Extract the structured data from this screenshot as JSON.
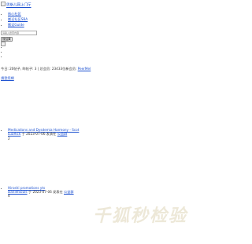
{
  "header": {
    "logo_alt": "思斯儿网上门厅"
  },
  "nav": {
    "items": [
      {
        "label": "核心社区"
      },
      {
        "label": "搬运社区SBA"
      },
      {
        "label": "搬运Guide"
      }
    ]
  },
  "search": {
    "placeholder": "请输入搜索内容",
    "button_label": "搜结果"
  },
  "stats": {
    "prefix": "今日: 20帖子, 昨帖子: 3 | 总会员: 23433位新会员:",
    "newest_user": "PeerMel"
  },
  "login": {
    "label": "請登您網"
  },
  "threads": [
    {
      "title": "Medications and Dysdemia Harmony - Scot",
      "author": "LuaRick",
      "meta_mid": "于 2023-07-06 发表在",
      "forum": "公益群",
      "count": "2"
    },
    {
      "title": "Hiroshi promotions yts",
      "author": "DanielSouls",
      "meta_mid": "于 2023-07-06 发表在",
      "forum": "公益群",
      "count": "4"
    }
  ],
  "watermark": {
    "text": "千狐秒检验"
  }
}
